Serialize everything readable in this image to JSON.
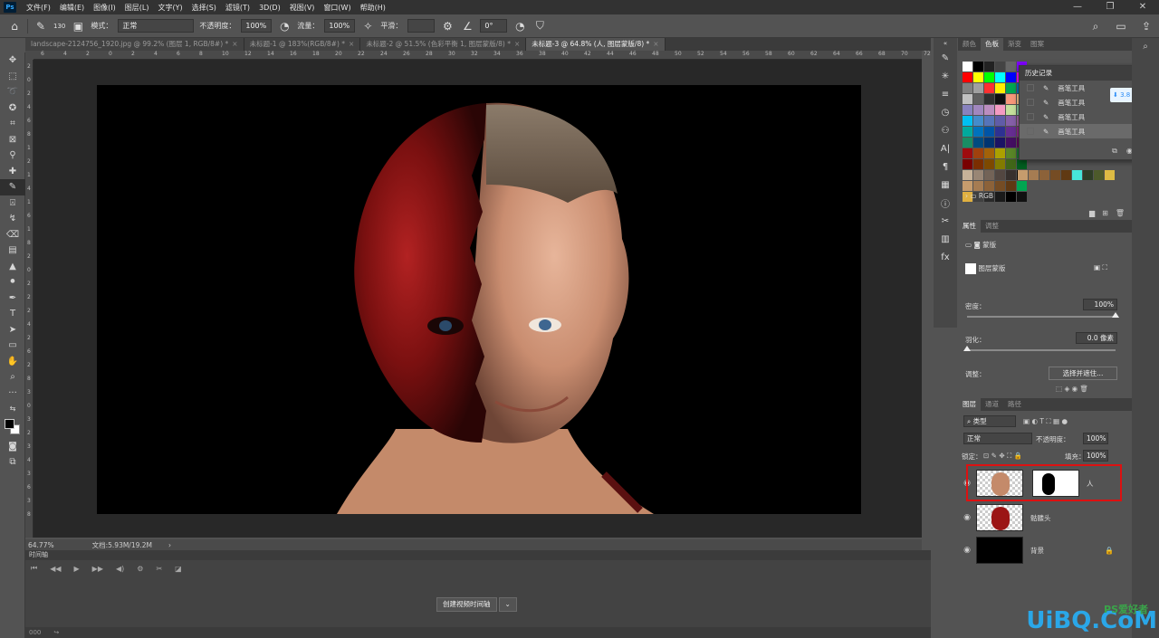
{
  "menubar": {
    "logo": "Ps",
    "items": [
      "文件(F)",
      "编辑(E)",
      "图像(I)",
      "图层(L)",
      "文字(Y)",
      "选择(S)",
      "滤镜(T)",
      "3D(D)",
      "视图(V)",
      "窗口(W)",
      "帮助(H)"
    ],
    "window_controls": [
      "—",
      "❐",
      "✕"
    ]
  },
  "options": {
    "brush_size": "130",
    "mode_label": "模式：",
    "mode_value": "正常",
    "opacity_label": "不透明度：",
    "opacity_value": "100%",
    "flow_label": "流量：",
    "flow_value": "100%",
    "smooth_label": "平滑：",
    "angle_value": "0°"
  },
  "tabs": [
    {
      "label": "landscape-2124756_1920.jpg @ 99.2% (图层 1, RGB/8#) *",
      "active": false
    },
    {
      "label": "未标题-1 @ 183%(RGB/8#) *",
      "active": false
    },
    {
      "label": "未标题-2 @ 51.5% (色彩平衡 1, 图层蒙版/8) *",
      "active": false
    },
    {
      "label": "未标题-3 @ 64.8% (人, 图层蒙版/8) *",
      "active": true
    }
  ],
  "ruler": {
    "h_ticks": [
      "6",
      "4",
      "2",
      "0",
      "2",
      "4",
      "6",
      "8",
      "10",
      "12",
      "14",
      "16",
      "18",
      "20",
      "22",
      "24",
      "26",
      "28",
      "30",
      "32",
      "34",
      "36",
      "38",
      "40",
      "42",
      "44",
      "46",
      "48",
      "50",
      "52",
      "54",
      "56",
      "58",
      "60",
      "62",
      "64",
      "66",
      "68",
      "70",
      "72"
    ],
    "v_ticks": [
      "2",
      "0",
      "2",
      "4",
      "6",
      "8",
      "1",
      "2",
      "1",
      "4",
      "1",
      "6",
      "1",
      "8",
      "2",
      "0",
      "2",
      "2",
      "2",
      "4",
      "2",
      "6",
      "2",
      "8",
      "3",
      "0",
      "3",
      "2",
      "3",
      "4",
      "3",
      "6",
      "3",
      "8"
    ]
  },
  "status": {
    "zoom": "64.77%",
    "doc": "文档:5.93M/19.2M",
    "arrow": "›"
  },
  "timeline": {
    "title": "时间轴",
    "create_button": "创建视频时间轴",
    "footer_left": "000"
  },
  "swatches": {
    "tabs": [
      "颜色",
      "色板",
      "渐变",
      "图案"
    ],
    "active_tab": 1,
    "colors": [
      [
        "#ffffff",
        "#000000",
        "#222222",
        "#444444",
        "#666666",
        "#7f00ff"
      ],
      [
        "#ff0000",
        "#ffff00",
        "#00ff00",
        "#00ffff",
        "#0000ff",
        "#ff00ff"
      ],
      [
        "#808080",
        "#a0a0a0",
        "#ff3030",
        "#ffee00",
        "#00a651",
        "#0072bc"
      ],
      [
        "#c0c0c0",
        "#606060",
        "#303030",
        "#101010",
        "#f7977a",
        "#fdc68a"
      ],
      [
        "#8882be",
        "#a187be",
        "#bc8dbf",
        "#f49ac2",
        "#c4df9b",
        "#82ca9d"
      ],
      [
        "#00bff3",
        "#448ccb",
        "#5674b9",
        "#605ca8",
        "#855fa8",
        "#a763a8"
      ],
      [
        "#00a99d",
        "#0072bc",
        "#0054a6",
        "#2e3192",
        "#662d91",
        "#92278f"
      ],
      [
        "#198c64",
        "#004b80",
        "#003471",
        "#1b1464",
        "#440e62",
        "#630460"
      ],
      [
        "#9e0b0f",
        "#a0410d",
        "#a36209",
        "#aba000",
        "#598527",
        "#1a7b30"
      ],
      [
        "#790000",
        "#7b2e00",
        "#7d4900",
        "#827b00",
        "#406618",
        "#005e20"
      ],
      [
        "#c7b299",
        "#998675",
        "#736357",
        "#534741",
        "#37302d",
        "#000000"
      ],
      [
        "#c69c6d",
        "#a67c52",
        "#8c6239",
        "#754c24",
        "#603913",
        "#00a651"
      ],
      [
        "#e0b040",
        "#404040",
        "#2a2a2a",
        "#1a1a1a",
        "#000000",
        "#111111"
      ]
    ],
    "extra_row": [
      "#c69c6d",
      "#a67c52",
      "#8c6239",
      "#754c24",
      "#603913",
      "#47e6d9",
      "#2f3d26",
      "#4d5a2b",
      "#ddbb44"
    ],
    "group_label": "RGB"
  },
  "history": {
    "title": "历史记录",
    "items": [
      "画笔工具",
      "画笔工具",
      "画笔工具",
      "画笔工具"
    ],
    "current_index": 3
  },
  "download_badge": "3.8 M/s",
  "properties": {
    "tabs": [
      "属性",
      "调整"
    ],
    "mask_label": "蒙版",
    "layer_mask_label": "图层蒙版",
    "density_label": "密度：",
    "density_value": "100%",
    "density_level": 1.0,
    "feather_label": "羽化：",
    "feather_value": "0.0 像素",
    "feather_level": 0.0,
    "adjust_label": "调整：",
    "select_button": "选择并遮住..."
  },
  "layers": {
    "tabs": [
      "图层",
      "通道",
      "路径"
    ],
    "filter_label": "类型",
    "blend_mode": "正常",
    "opacity_label": "不透明度：",
    "opacity_value": "100%",
    "lock_label": "锁定：",
    "fill_label": "填充：",
    "fill_value": "100%",
    "list": [
      {
        "name": "人",
        "has_mask": true,
        "selected": true
      },
      {
        "name": "骷髅头",
        "has_mask": false,
        "selected": false
      },
      {
        "name": "背景",
        "has_mask": false,
        "selected": false,
        "locked": true
      }
    ]
  },
  "watermark": "UiBQ.CoM",
  "watermark_small": "PS爱好者"
}
